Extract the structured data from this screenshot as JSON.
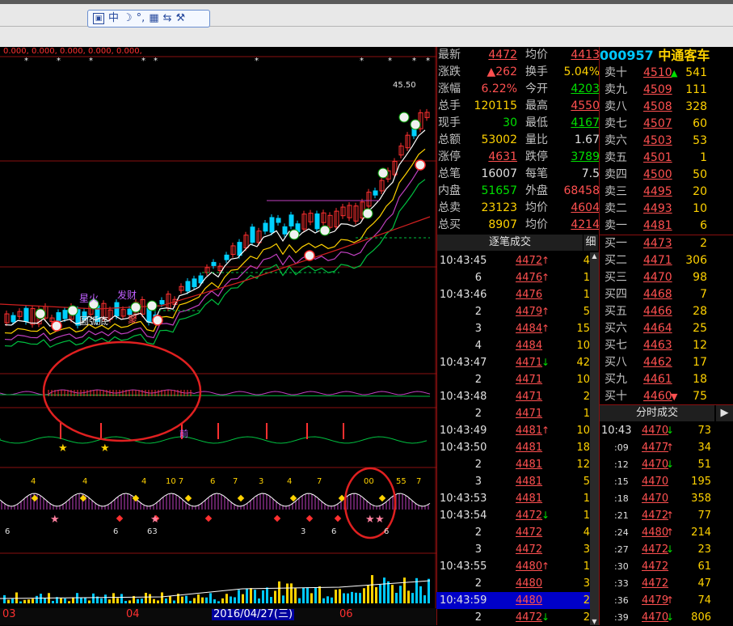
{
  "toolbar": {
    "ime_labels": [
      "中",
      "☽",
      "°,",
      "▦",
      "⇆",
      "⚒"
    ]
  },
  "chart": {
    "indicator_values": "0.000, 0.000, 0.000, 0.000, 0.000,",
    "high_label": "45.50",
    "pattern_label": "圆弧底",
    "annot_1": "星火",
    "annot_2": "发财",
    "annot_3": "前",
    "annot_4": "聚",
    "numbers_row": [
      "4",
      "4",
      "4",
      "10 7",
      "6",
      "7",
      "3",
      "4",
      "7",
      "00",
      "55",
      "7"
    ],
    "bottom_numbers": [
      "6",
      "6",
      "63",
      "3",
      "6",
      "6"
    ],
    "date_labels": {
      "m1": "03",
      "m2": "04",
      "date": "2016/04/27(三)",
      "m3": "06"
    }
  },
  "quote": {
    "rows": [
      {
        "l1": "最新",
        "v1": "4472",
        "c1": "#ff5050",
        "u1": true,
        "l2": "均价",
        "v2": "4413",
        "c2": "#ff5050",
        "u2": true
      },
      {
        "l1": "涨跌",
        "v1": "▲262",
        "c1": "#ff5050",
        "u1": false,
        "l2": "换手",
        "v2": "5.04%",
        "c2": "#ffd200",
        "u2": false
      },
      {
        "l1": "涨幅",
        "v1": "6.22%",
        "c1": "#ff5050",
        "u1": false,
        "l2": "今开",
        "v2": "4203",
        "c2": "#00e000",
        "u2": true
      },
      {
        "l1": "总手",
        "v1": "120115",
        "c1": "#ffd200",
        "u1": false,
        "l2": "最高",
        "v2": "4550",
        "c2": "#ff5050",
        "u2": true
      },
      {
        "l1": "现手",
        "v1": "30",
        "c1": "#00e000",
        "u1": false,
        "l2": "最低",
        "v2": "4167",
        "c2": "#00e000",
        "u2": true
      },
      {
        "l1": "总额",
        "v1": "53002",
        "c1": "#ffd200",
        "u1": false,
        "l2": "量比",
        "v2": "1.67",
        "c2": "#e0e0e0",
        "u2": false
      },
      {
        "l1": "涨停",
        "v1": "4631",
        "c1": "#ff5050",
        "u1": true,
        "l2": "跌停",
        "v2": "3789",
        "c2": "#00e000",
        "u2": true
      },
      {
        "l1": "总笔",
        "v1": "16007",
        "c1": "#e0e0e0",
        "u1": false,
        "l2": "每笔",
        "v2": "7.5",
        "c2": "#e0e0e0",
        "u2": false
      },
      {
        "l1": "内盘",
        "v1": "51657",
        "c1": "#00e000",
        "u1": false,
        "l2": "外盘",
        "v2": "68458",
        "c2": "#ff5050",
        "u2": false
      },
      {
        "l1": "总卖",
        "v1": "23123",
        "c1": "#ffd200",
        "u1": false,
        "l2": "均价",
        "v2": "4604",
        "c2": "#ff5050",
        "u2": true
      },
      {
        "l1": "总买",
        "v1": "8907",
        "c1": "#ffd200",
        "u1": false,
        "l2": "均价",
        "v2": "4214",
        "c2": "#ff5050",
        "u2": true
      }
    ]
  },
  "stock": {
    "code": "000957",
    "name": "中通客车"
  },
  "orderbook": [
    {
      "label": "卖十",
      "price": "4510",
      "arrow": "▲",
      "arrow_color": "#00e000",
      "vol": "541"
    },
    {
      "label": "卖九",
      "price": "4509",
      "arrow": "",
      "arrow_color": "",
      "vol": "111"
    },
    {
      "label": "卖八",
      "price": "4508",
      "arrow": "",
      "arrow_color": "",
      "vol": "328"
    },
    {
      "label": "卖七",
      "price": "4507",
      "arrow": "",
      "arrow_color": "",
      "vol": "60"
    },
    {
      "label": "卖六",
      "price": "4503",
      "arrow": "",
      "arrow_color": "",
      "vol": "53"
    },
    {
      "label": "卖五",
      "price": "4501",
      "arrow": "",
      "arrow_color": "",
      "vol": "1"
    },
    {
      "label": "卖四",
      "price": "4500",
      "arrow": "",
      "arrow_color": "",
      "vol": "50"
    },
    {
      "label": "卖三",
      "price": "4495",
      "arrow": "",
      "arrow_color": "",
      "vol": "20"
    },
    {
      "label": "卖二",
      "price": "4493",
      "arrow": "",
      "arrow_color": "",
      "vol": "10"
    },
    {
      "label": "卖一",
      "price": "4481",
      "arrow": "",
      "arrow_color": "",
      "vol": "6"
    },
    {
      "label": "买一",
      "price": "4473",
      "arrow": "",
      "arrow_color": "",
      "vol": "2"
    },
    {
      "label": "买二",
      "price": "4471",
      "arrow": "",
      "arrow_color": "",
      "vol": "306"
    },
    {
      "label": "买三",
      "price": "4470",
      "arrow": "",
      "arrow_color": "",
      "vol": "98"
    },
    {
      "label": "买四",
      "price": "4468",
      "arrow": "",
      "arrow_color": "",
      "vol": "7"
    },
    {
      "label": "买五",
      "price": "4466",
      "arrow": "",
      "arrow_color": "",
      "vol": "28"
    },
    {
      "label": "买六",
      "price": "4464",
      "arrow": "",
      "arrow_color": "",
      "vol": "25"
    },
    {
      "label": "买七",
      "price": "4463",
      "arrow": "",
      "arrow_color": "",
      "vol": "12"
    },
    {
      "label": "买八",
      "price": "4462",
      "arrow": "",
      "arrow_color": "",
      "vol": "17"
    },
    {
      "label": "买九",
      "price": "4461",
      "arrow": "",
      "arrow_color": "",
      "vol": "18"
    },
    {
      "label": "买十",
      "price": "4460",
      "arrow": "▼",
      "arrow_color": "#ff5050",
      "vol": "75"
    }
  ],
  "trades_panel": {
    "title": "逐笔成交",
    "tab": "细"
  },
  "trades": [
    {
      "time": "10:43:45",
      "price": "4472",
      "arrow": "↑",
      "arrow_color": "#ff5050",
      "vol": "4"
    },
    {
      "time": "6",
      "price": "4476",
      "arrow": "↑",
      "arrow_color": "#ff5050",
      "vol": "1"
    },
    {
      "time": "10:43:46",
      "price": "4476",
      "arrow": "",
      "arrow_color": "",
      "vol": "1"
    },
    {
      "time": "2",
      "price": "4479",
      "arrow": "↑",
      "arrow_color": "#ff5050",
      "vol": "5"
    },
    {
      "time": "3",
      "price": "4484",
      "arrow": "↑",
      "arrow_color": "#ff5050",
      "vol": "15"
    },
    {
      "time": "4",
      "price": "4484",
      "arrow": "",
      "arrow_color": "",
      "vol": "10"
    },
    {
      "time": "10:43:47",
      "price": "4471",
      "arrow": "↓",
      "arrow_color": "#00e000",
      "vol": "42"
    },
    {
      "time": "2",
      "price": "4471",
      "arrow": "",
      "arrow_color": "",
      "vol": "10"
    },
    {
      "time": "10:43:48",
      "price": "4471",
      "arrow": "",
      "arrow_color": "",
      "vol": "2"
    },
    {
      "time": "2",
      "price": "4471",
      "arrow": "",
      "arrow_color": "",
      "vol": "1"
    },
    {
      "time": "10:43:49",
      "price": "4481",
      "arrow": "↑",
      "arrow_color": "#ff5050",
      "vol": "10"
    },
    {
      "time": "10:43:50",
      "price": "4481",
      "arrow": "",
      "arrow_color": "",
      "vol": "18"
    },
    {
      "time": "2",
      "price": "4481",
      "arrow": "",
      "arrow_color": "",
      "vol": "12"
    },
    {
      "time": "3",
      "price": "4481",
      "arrow": "",
      "arrow_color": "",
      "vol": "5"
    },
    {
      "time": "10:43:53",
      "price": "4481",
      "arrow": "",
      "arrow_color": "",
      "vol": "1"
    },
    {
      "time": "10:43:54",
      "price": "4472",
      "arrow": "↓",
      "arrow_color": "#00e000",
      "vol": "1"
    },
    {
      "time": "2",
      "price": "4472",
      "arrow": "",
      "arrow_color": "",
      "vol": "4"
    },
    {
      "time": "3",
      "price": "4472",
      "arrow": "",
      "arrow_color": "",
      "vol": "3"
    },
    {
      "time": "10:43:55",
      "price": "4480",
      "arrow": "↑",
      "arrow_color": "#ff5050",
      "vol": "1"
    },
    {
      "time": "2",
      "price": "4480",
      "arrow": "",
      "arrow_color": "",
      "vol": "3"
    },
    {
      "time": "10:43:59",
      "price": "4480",
      "arrow": "",
      "arrow_color": "",
      "vol": "2"
    },
    {
      "time": "2",
      "price": "4472",
      "arrow": "↓",
      "arrow_color": "#00e000",
      "vol": "2"
    }
  ],
  "minute_panel": {
    "title": "分时成交"
  },
  "minutes": [
    {
      "time": "10:43",
      "price": "4470",
      "arrow": "↓",
      "arrow_color": "#00e000",
      "vol": "73"
    },
    {
      "time": ":09",
      "price": "4477",
      "arrow": "↑",
      "arrow_color": "#ff5050",
      "vol": "34"
    },
    {
      "time": ":12",
      "price": "4470",
      "arrow": "↓",
      "arrow_color": "#00e000",
      "vol": "51"
    },
    {
      "time": ":15",
      "price": "4470",
      "arrow": "",
      "arrow_color": "",
      "vol": "195"
    },
    {
      "time": ":18",
      "price": "4470",
      "arrow": "",
      "arrow_color": "",
      "vol": "358"
    },
    {
      "time": ":21",
      "price": "4472",
      "arrow": "↑",
      "arrow_color": "#ff5050",
      "vol": "77"
    },
    {
      "time": ":24",
      "price": "4480",
      "arrow": "↑",
      "arrow_color": "#ff5050",
      "vol": "214"
    },
    {
      "time": ":27",
      "price": "4472",
      "arrow": "↓",
      "arrow_color": "#00e000",
      "vol": "23"
    },
    {
      "time": ":30",
      "price": "4472",
      "arrow": "",
      "arrow_color": "",
      "vol": "61"
    },
    {
      "time": ":33",
      "price": "4472",
      "arrow": "",
      "arrow_color": "",
      "vol": "47"
    },
    {
      "time": ":36",
      "price": "4479",
      "arrow": "↑",
      "arrow_color": "#ff5050",
      "vol": "74"
    },
    {
      "time": ":39",
      "price": "4470",
      "arrow": "↓",
      "arrow_color": "#00e000",
      "vol": "806"
    }
  ]
}
